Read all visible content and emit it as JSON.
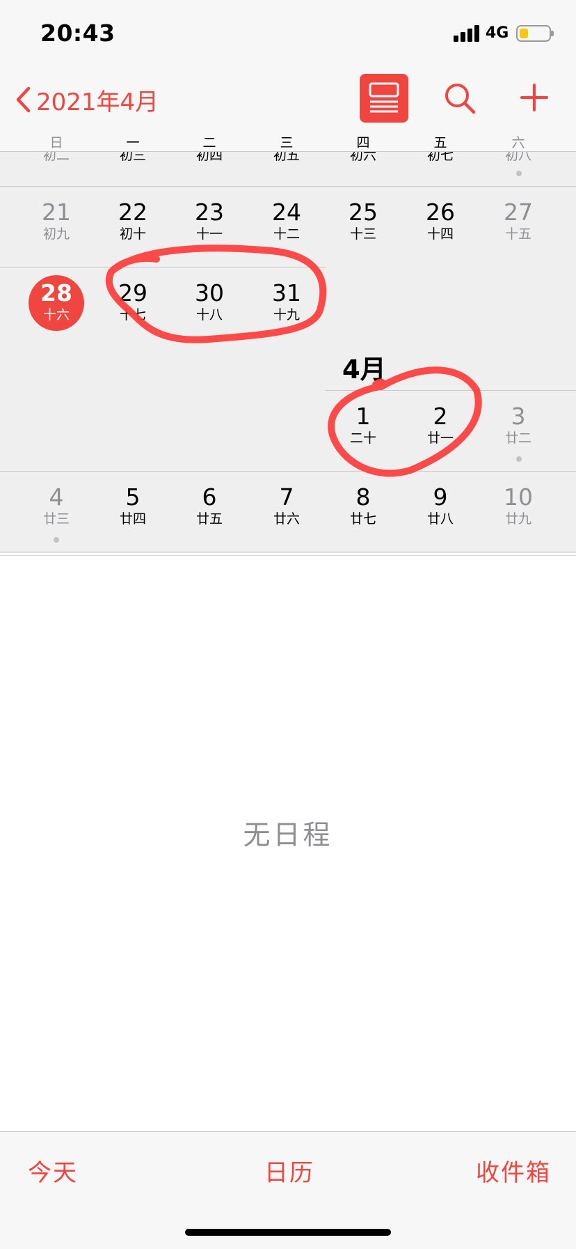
{
  "status": {
    "time": "20:43",
    "network": "4G",
    "battery_level": 0.3
  },
  "nav": {
    "back_label": "2021年4月"
  },
  "weekdays": [
    "日",
    "一",
    "二",
    "三",
    "四",
    "五",
    "六"
  ],
  "partial_week": [
    "初二",
    "初三",
    "初四",
    "初五",
    "初六",
    "初七",
    "初八"
  ],
  "week_1": [
    {
      "num": "21",
      "lunar": "初九"
    },
    {
      "num": "22",
      "lunar": "初十"
    },
    {
      "num": "23",
      "lunar": "十一"
    },
    {
      "num": "24",
      "lunar": "十二"
    },
    {
      "num": "25",
      "lunar": "十三"
    },
    {
      "num": "26",
      "lunar": "十四"
    },
    {
      "num": "27",
      "lunar": "十五"
    }
  ],
  "week_2": [
    {
      "num": "28",
      "lunar": "十六"
    },
    {
      "num": "29",
      "lunar": "十七"
    },
    {
      "num": "30",
      "lunar": "十八"
    },
    {
      "num": "31",
      "lunar": "十九"
    }
  ],
  "month_label": "4月",
  "week_3": [
    {
      "num": "1",
      "lunar": "二十"
    },
    {
      "num": "2",
      "lunar": "廿一"
    },
    {
      "num": "3",
      "lunar": "廿二"
    }
  ],
  "week_4": [
    {
      "num": "4",
      "lunar": "廿三"
    },
    {
      "num": "5",
      "lunar": "廿四"
    },
    {
      "num": "6",
      "lunar": "廿五"
    },
    {
      "num": "7",
      "lunar": "廿六"
    },
    {
      "num": "8",
      "lunar": "廿七"
    },
    {
      "num": "9",
      "lunar": "廿八"
    },
    {
      "num": "10",
      "lunar": "廿九"
    }
  ],
  "empty_state": "无日程",
  "tabs": {
    "today": "今天",
    "calendars": "日历",
    "inbox": "收件箱"
  },
  "colors": {
    "accent": "#f0463f",
    "weekend": "#8e8e93",
    "annotation": "#ff3b3b"
  }
}
